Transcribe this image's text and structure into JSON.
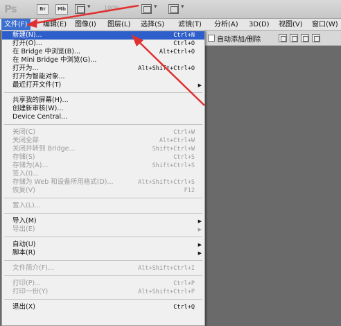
{
  "appbar": {
    "logo": "Ps",
    "br_label": "Br",
    "mb_label": "Mb",
    "zoom_text": "100%"
  },
  "menubar": {
    "items": [
      "文件(F)",
      "编辑(E)",
      "图像(I)",
      "图层(L)",
      "选择(S)",
      "滤镜(T)",
      "分析(A)",
      "3D(D)",
      "视图(V)",
      "窗口(W)"
    ]
  },
  "options": {
    "auto_add_delete_label": "自动添加/删除"
  },
  "file_menu": {
    "new": {
      "label": "新建(N)...",
      "shortcut": "Ctrl+N"
    },
    "open": {
      "label": "打开(O)...",
      "shortcut": "Ctrl+O"
    },
    "browse_bridge": {
      "label": "在 Bridge 中浏览(B)...",
      "shortcut": "Alt+Ctrl+O"
    },
    "browse_mini_bridge": {
      "label": "在 Mini Bridge 中浏览(G)..."
    },
    "open_as": {
      "label": "打开为...",
      "shortcut": "Alt+Shift+Ctrl+O"
    },
    "open_smart_object": {
      "label": "打开为智能对象..."
    },
    "recent": {
      "label": "最近打开文件(T)"
    },
    "share_screen": {
      "label": "共享我的屏幕(H)..."
    },
    "new_review": {
      "label": "创建新审核(W)..."
    },
    "device_central": {
      "label": "Device Central..."
    },
    "close": {
      "label": "关闭(C)",
      "shortcut": "Ctrl+W"
    },
    "close_all": {
      "label": "关闭全部",
      "shortcut": "Alt+Ctrl+W"
    },
    "close_to_bridge": {
      "label": "关闭并转到 Bridge...",
      "shortcut": "Shift+Ctrl+W"
    },
    "save": {
      "label": "存储(S)",
      "shortcut": "Ctrl+S"
    },
    "save_as": {
      "label": "存储为(A)...",
      "shortcut": "Shift+Ctrl+S"
    },
    "check_in": {
      "label": "签入(I)..."
    },
    "save_for_web": {
      "label": "存储为 Web 和设备所用格式(D)...",
      "shortcut": "Alt+Shift+Ctrl+S"
    },
    "revert": {
      "label": "恢复(V)",
      "shortcut": "F12"
    },
    "place": {
      "label": "置入(L)..."
    },
    "import": {
      "label": "导入(M)"
    },
    "export": {
      "label": "导出(E)"
    },
    "automate": {
      "label": "自动(U)"
    },
    "scripts": {
      "label": "脚本(R)"
    },
    "file_info": {
      "label": "文件简介(F)...",
      "shortcut": "Alt+Shift+Ctrl+I"
    },
    "print": {
      "label": "打印(P)...",
      "shortcut": "Ctrl+P"
    },
    "print_one": {
      "label": "打印一份(Y)",
      "shortcut": "Alt+Shift+Ctrl+P"
    },
    "exit": {
      "label": "退出(X)",
      "shortcut": "Ctrl+Q"
    }
  },
  "colors": {
    "highlight": "#2e5ec9",
    "annotation_arrow": "#e03030"
  }
}
